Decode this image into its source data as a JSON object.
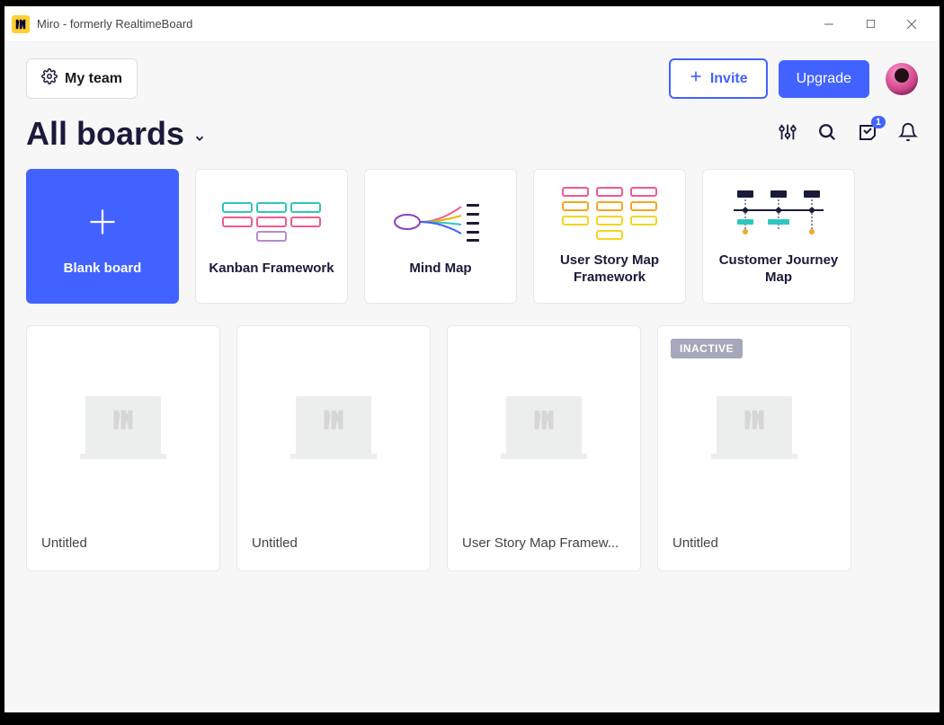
{
  "window": {
    "title": "Miro - formerly RealtimeBoard"
  },
  "topbar": {
    "team_label": "My team",
    "invite_label": "Invite",
    "upgrade_label": "Upgrade"
  },
  "heading": "All boards",
  "inbox_badge": "1",
  "templates": [
    {
      "label": "Blank board",
      "kind": "blank"
    },
    {
      "label": "Kanban Framework",
      "kind": "kanban"
    },
    {
      "label": "Mind Map",
      "kind": "mindmap"
    },
    {
      "label": "User Story Map Framework",
      "kind": "usm"
    },
    {
      "label": "Customer Journey Map",
      "kind": "cjm"
    }
  ],
  "boards": [
    {
      "title": "Untitled",
      "inactive": false
    },
    {
      "title": "Untitled",
      "inactive": false
    },
    {
      "title": "User Story Map Framew...",
      "inactive": false
    },
    {
      "title": "Untitled",
      "inactive": true
    }
  ],
  "inactive_label": "INACTIVE"
}
